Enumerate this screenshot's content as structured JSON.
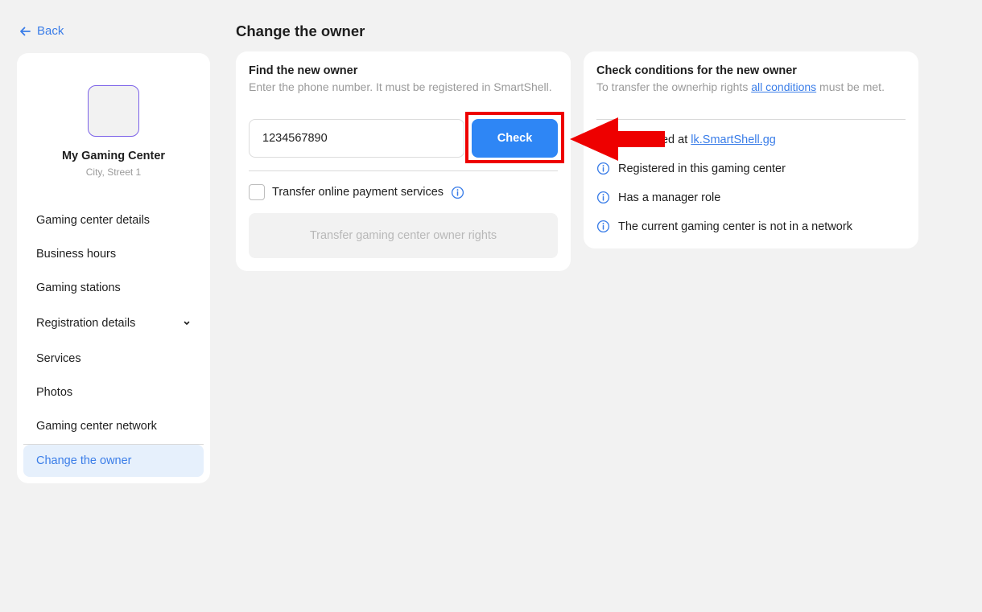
{
  "back": {
    "label": "Back"
  },
  "sidebar": {
    "center_name": "My Gaming Center",
    "center_address": "City, Street 1",
    "items": [
      {
        "label": "Gaming center details"
      },
      {
        "label": "Business hours"
      },
      {
        "label": "Gaming stations"
      },
      {
        "label": "Registration details"
      },
      {
        "label": "Services"
      },
      {
        "label": "Photos"
      },
      {
        "label": "Gaming center network"
      },
      {
        "label": "Change the owner"
      }
    ],
    "active_item": "Change the owner"
  },
  "page": {
    "title": "Change the owner"
  },
  "find_owner": {
    "title": "Find the new owner",
    "subtitle": "Enter the phone number. It must be registered in SmartShell.",
    "phone_value": "1234567890",
    "check_label": "Check",
    "transfer_payment_label": "Transfer online payment services",
    "transfer_payment_checked": false,
    "transfer_button_label": "Transfer gaming center owner rights"
  },
  "conditions": {
    "title": "Check conditions for the new owner",
    "subtitle_prefix": "To transfer the ownerhip rights ",
    "subtitle_link": "all conditions",
    "subtitle_suffix": " must be met.",
    "items": [
      {
        "text": "Registered at ",
        "link": "lk.SmartShell.gg"
      },
      {
        "text": "Registered in this gaming center"
      },
      {
        "text": "Has a manager role"
      },
      {
        "text": "The current gaming center is not in a network"
      }
    ]
  },
  "colors": {
    "accent": "#2e86f5",
    "link": "#3a7de8",
    "highlight": "#ee0000",
    "background": "#f2f2f2"
  },
  "icons": [
    "arrow-left-icon",
    "chevron-down-icon",
    "info-icon"
  ]
}
